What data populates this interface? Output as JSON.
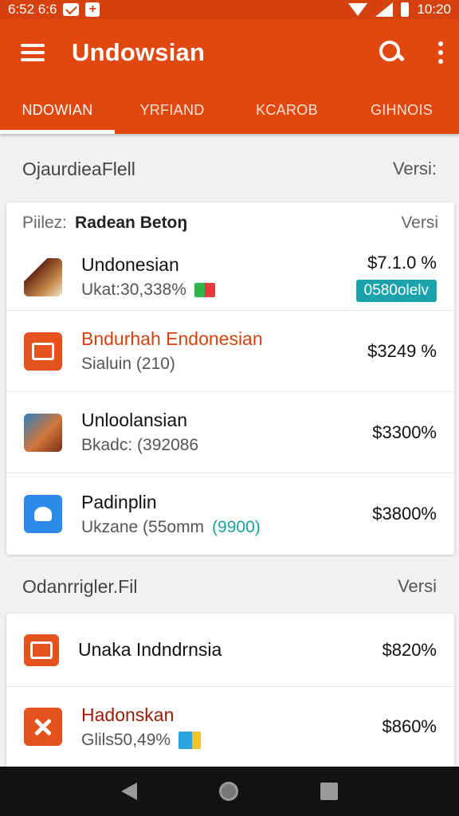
{
  "status_bar": {
    "left_text": "6:52 6:6",
    "time": "10:20"
  },
  "app_bar": {
    "title": "Undowsian"
  },
  "tabs": [
    {
      "label": "NDOWIAN",
      "active": true
    },
    {
      "label": "YRFIAND",
      "active": false
    },
    {
      "label": "KCAROB",
      "active": false
    },
    {
      "label": "GIHNOIS",
      "active": false
    }
  ],
  "section1": {
    "title": "OjaurdieaFlell",
    "right": "Versi:"
  },
  "card1": {
    "head_muted": "Piilez:",
    "head_strong": "Radean Betoŋ",
    "head_right": "Versi",
    "rows": [
      {
        "title": "Undonesian",
        "sub": "Ukat:30,338%",
        "value": "$7.1.0 %",
        "badge": "0580olelv",
        "icon": "people-icon"
      },
      {
        "title": "Bndurhah Endonesian",
        "sub": "Sialuin (210)",
        "value": "$3249 %",
        "icon": "card-icon"
      },
      {
        "title": "Unloolansian",
        "sub": "Bkadc: (392086",
        "value": "$3300%",
        "icon": "photo-icon"
      },
      {
        "title": "Padinplin",
        "sub": "Ukzane (55omm",
        "sub_teal": "(9900)",
        "value": "$3800%",
        "icon": "map-icon"
      }
    ]
  },
  "section2": {
    "title": "Odanrrigler.Fil",
    "right": "Versi"
  },
  "card2": {
    "rows": [
      {
        "title": "Unaka Indndrnsia",
        "value": "$820%",
        "icon": "card-icon"
      },
      {
        "title": "Hadonskan",
        "sub": "Glils50,49%",
        "value": "$860%",
        "icon": "close-icon"
      }
    ]
  },
  "colors": {
    "primary": "#e0480f",
    "status": "#d6420f",
    "accent": "#1ba2ab"
  }
}
